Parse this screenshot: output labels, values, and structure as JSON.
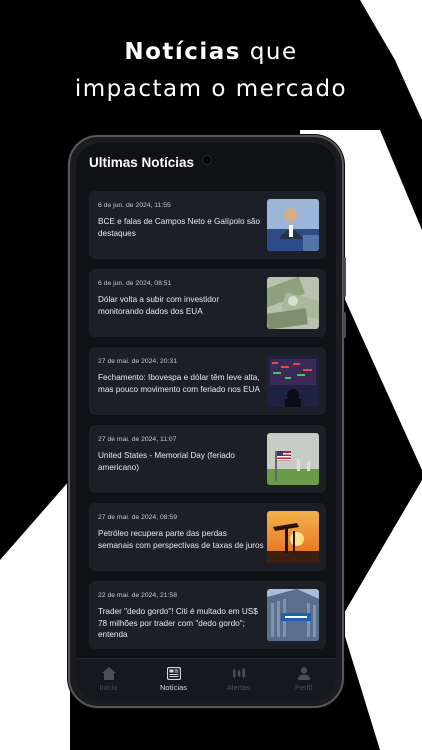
{
  "headline": {
    "bold": "Notícias",
    "rest_line1": " que",
    "line2": "impactam  o mercado"
  },
  "screen": {
    "title": "Ultimas Notícias"
  },
  "news": [
    {
      "date": "6 de jun. de 2024, 11:55",
      "headline": "BCE e falas de Campos Neto e Galípolo são destaques",
      "thumb_icon": "speaker-photo"
    },
    {
      "date": "6 de jun. de 2024, 08:51",
      "headline": "Dólar volta a subir com investidor monitorando dados dos EUA",
      "thumb_icon": "dollar-bills-photo"
    },
    {
      "date": "27 de mai. de 2024, 20:31",
      "headline": "Fechamento: Ibovespa e dólar têm leve alta, mas pouco movimento com feriado nos EUA",
      "thumb_icon": "stock-board-photo"
    },
    {
      "date": "27 de mai. de 2024, 11:07",
      "headline": "United States - Memorial Day (feriado americano)",
      "thumb_icon": "us-flag-photo"
    },
    {
      "date": "27 de mai. de 2024, 08:59",
      "headline": "Petróleo recupera parte das perdas semanais com perspectivas de taxas de juros",
      "thumb_icon": "oil-pump-photo"
    },
    {
      "date": "22 de mai. de 2024, 21:58",
      "headline": "Trader \"dedo gordo\"! Citi é multado em US$ 78 milhões por trader com \"dedo gordo\"; entenda",
      "thumb_icon": "citibank-photo"
    }
  ],
  "nav": [
    {
      "label": "Início",
      "icon": "home-icon",
      "active": false
    },
    {
      "label": "Notícias",
      "icon": "newspaper-icon",
      "active": true
    },
    {
      "label": "Alertas",
      "icon": "candlestick-icon",
      "active": false
    },
    {
      "label": "Perfil",
      "icon": "user-icon",
      "active": false
    }
  ],
  "colors": {
    "background": "#000000",
    "card": "#1d1f26",
    "screen": "#101114",
    "nav_active": "#d8d9de",
    "nav_inactive": "#4c4e56"
  }
}
